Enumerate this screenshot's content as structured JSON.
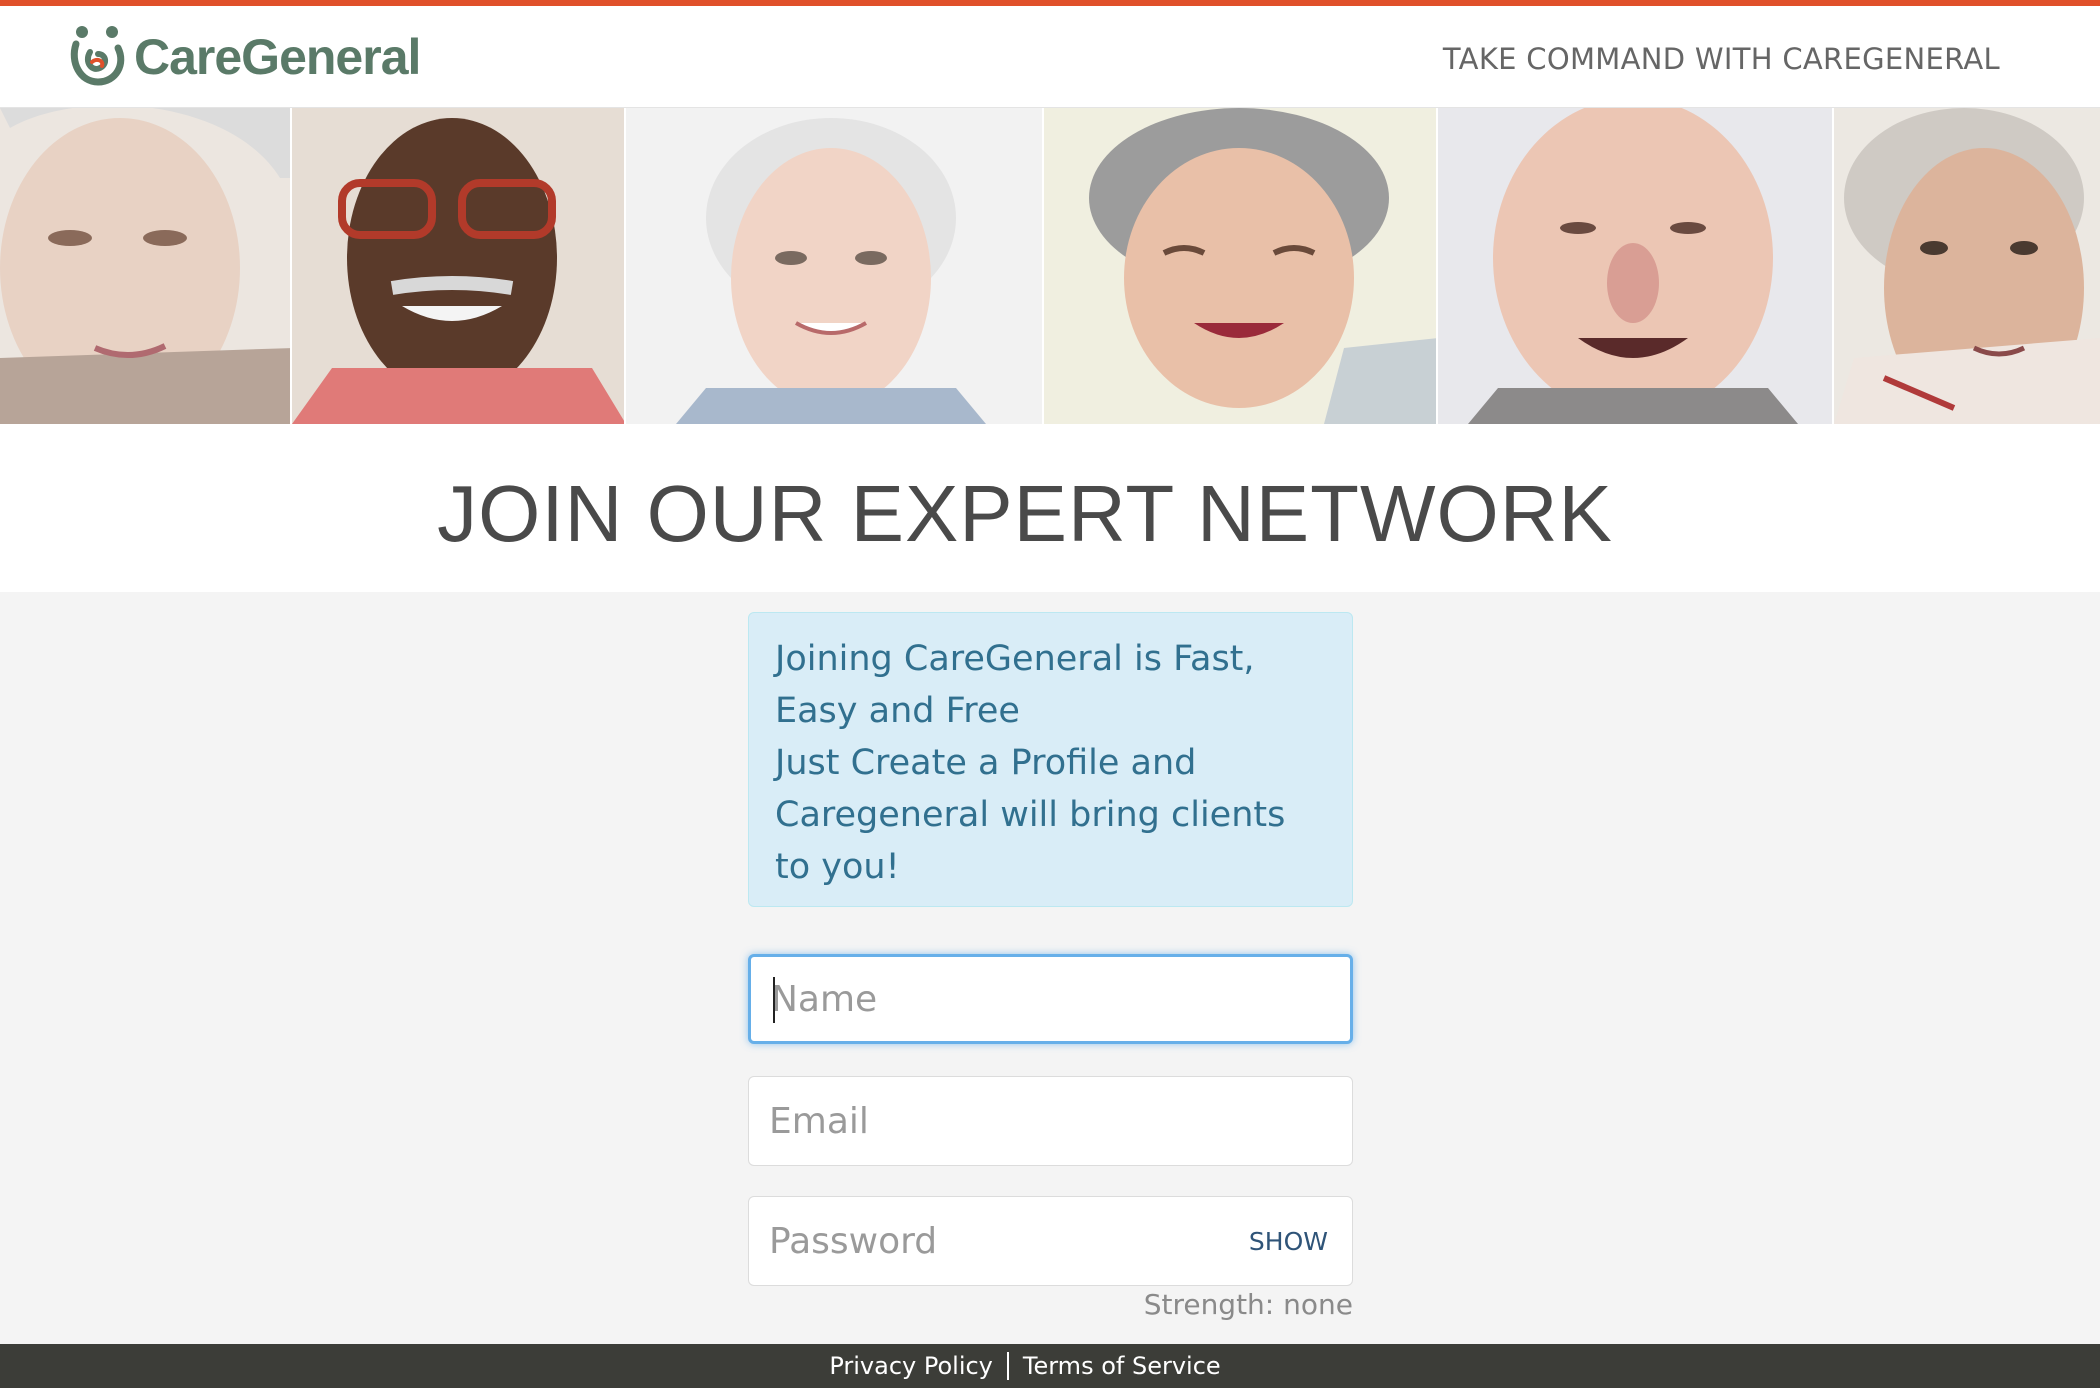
{
  "header": {
    "logo_text": "CareGeneral",
    "tagline": "TAKE COMMAND WITH CAREGENERAL"
  },
  "main": {
    "title": "JOIN OUR EXPERT NETWORK",
    "info_lines": [
      "Joining CareGeneral is Fast,",
      "Easy and Free",
      "Just Create a Profile and",
      "Caregeneral will bring clients",
      "to you!"
    ]
  },
  "form": {
    "name": {
      "placeholder": "Name",
      "value": ""
    },
    "email": {
      "placeholder": "Email",
      "value": ""
    },
    "password": {
      "placeholder": "Password",
      "value": "",
      "show_label": "SHOW"
    },
    "strength_text": "Strength: none"
  },
  "footer": {
    "privacy_label": "Privacy Policy",
    "terms_label": "Terms of Service"
  },
  "colors": {
    "accent_bar": "#e0502a",
    "brand_green": "#5a7a68",
    "info_bg": "#d9edf7",
    "info_text": "#31708f",
    "focus_blue": "#66afe9",
    "footer_bg": "#3c3d38"
  },
  "icons": {
    "logo": "caregeneral-logo-icon"
  }
}
